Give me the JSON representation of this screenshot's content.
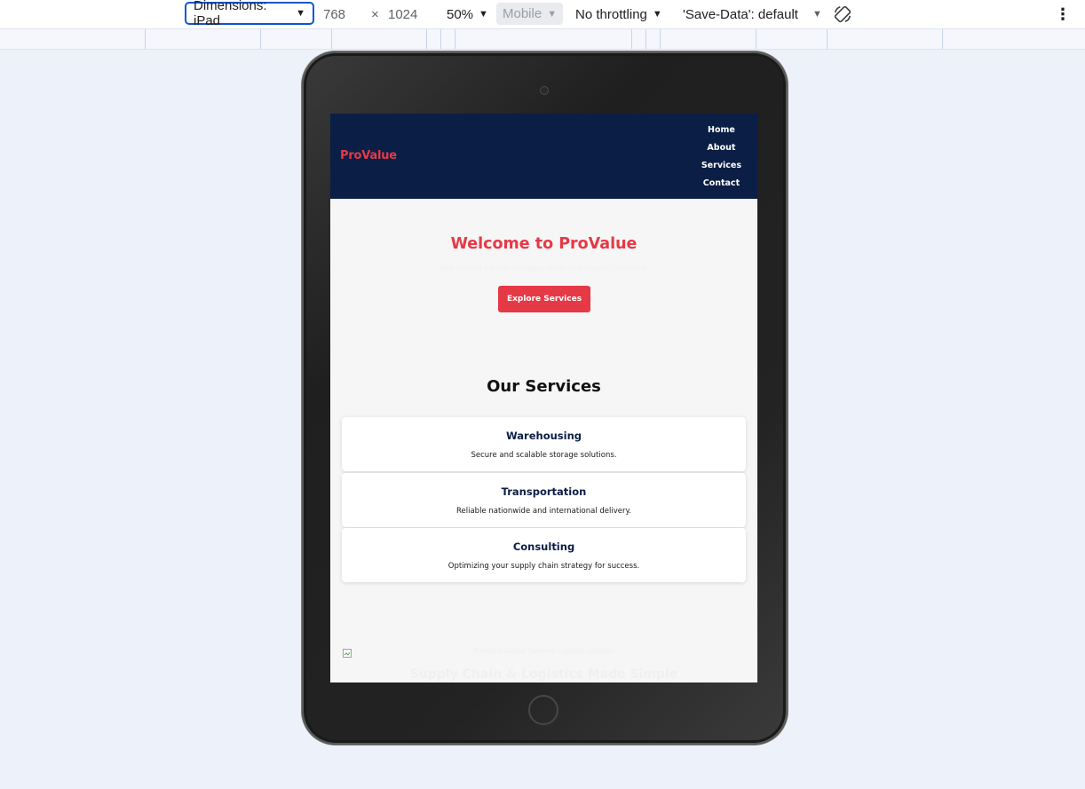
{
  "devtools": {
    "dimensions_label": "Dimensions: iPad",
    "width": "768",
    "times": "×",
    "height": "1024",
    "zoom": "50%",
    "device_type": "Mobile",
    "throttling": "No throttling",
    "save_data": "'Save-Data': default",
    "icons": {
      "rotate": "rotate-icon",
      "more": "more-vertical-icon",
      "caret": "caret-down-icon"
    },
    "accent": "#0b57d0"
  },
  "site": {
    "logo": "ProValue",
    "nav": [
      "Home",
      "About",
      "Services",
      "Contact"
    ],
    "hero": {
      "title": "Welcome to ProValue",
      "subtitle": "Your trusted partner in supply chain and logistics solutions.",
      "button": "Explore Services"
    },
    "services": {
      "title": "Our Services",
      "items": [
        {
          "title": "Warehousing",
          "desc": "Secure and scalable storage solutions."
        },
        {
          "title": "Transportation",
          "desc": "Reliable nationwide and international delivery."
        },
        {
          "title": "Consulting",
          "desc": "Optimizing your supply chain strategy for success."
        }
      ]
    },
    "image_alt": "ProValue Global Network logistics solution",
    "bottom_heading": "Supply Chain & Logistics Made Simple",
    "colors": {
      "header": "#0b1e45",
      "accent": "#e63946",
      "background": "#f6f6f6"
    }
  }
}
